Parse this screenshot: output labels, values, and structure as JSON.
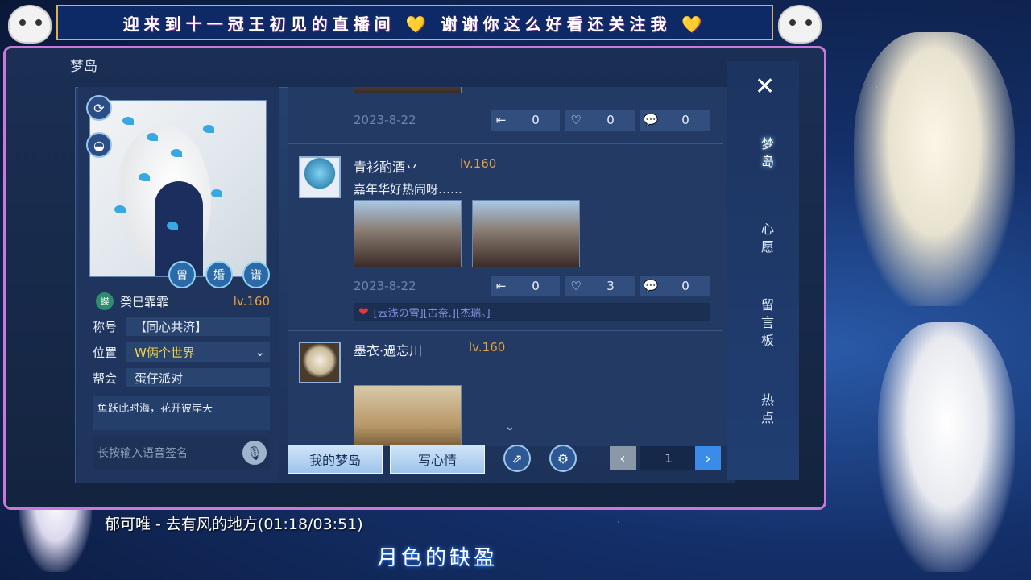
{
  "banner": {
    "text": "迎来到十一冠王初见的直播间 💛 谢谢你这么好看还关注我 💛"
  },
  "window": {
    "title": "梦岛"
  },
  "profile": {
    "badges": [
      "曾",
      "婚",
      "谱"
    ],
    "name_icon": "蝶",
    "name": "癸巳霏霏",
    "level": "lv.160",
    "fields": [
      {
        "key": "称号",
        "value": "【同心共济】"
      },
      {
        "key": "位置",
        "value": "W俩个世界"
      },
      {
        "key": "帮会",
        "value": "蛋仔派对"
      }
    ],
    "motto": "鱼跃此时海，花开彼岸天",
    "voice_placeholder": "长按输入语音签名"
  },
  "feed": {
    "posts": [
      {
        "date": "2023-8-22",
        "stats": {
          "reposts": "0",
          "likes": "0",
          "comments": "0"
        }
      },
      {
        "name": "青衫酌酒丷",
        "level": "lv.160",
        "text": "嘉年华好热闹呀……",
        "date": "2023-8-22",
        "stats": {
          "reposts": "0",
          "likes": "3",
          "comments": "0"
        },
        "liked_by": "[云浅の雪][古奈.][杰瑞。]"
      },
      {
        "name": "墨衣·過忘川",
        "level": "lv.160"
      }
    ]
  },
  "toolbar": {
    "my_island": "我的梦岛",
    "write_mood": "写心情",
    "page": "1"
  },
  "right_nav": {
    "tabs": [
      "梦岛",
      "心愿",
      "留言板",
      "热点"
    ]
  },
  "stream": {
    "song": "郁可唯 - 去有风的地方(01:18/03:51)",
    "lyric": "月色的缺盈"
  },
  "colors": {
    "accent": "#e8a040",
    "frame": "#c77ad8",
    "banner_border": "#e0b04a"
  }
}
